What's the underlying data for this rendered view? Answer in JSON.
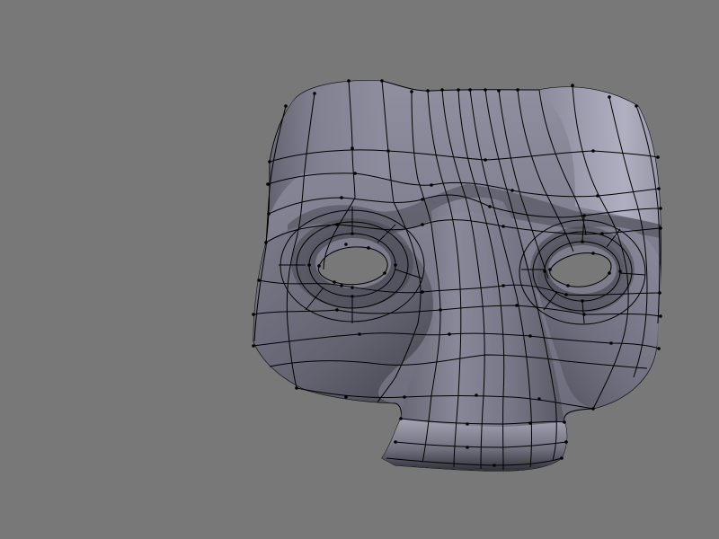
{
  "viewport": {
    "background_color": "#787878",
    "mesh_surface_color": "#6f6f7d",
    "mesh_highlight_color": "#a6a6b8",
    "mesh_shadow_color": "#3a3a44",
    "wire_color": "#000000",
    "hole_color": "#ffffff",
    "object_icon": "face-mask-mesh-icon"
  }
}
